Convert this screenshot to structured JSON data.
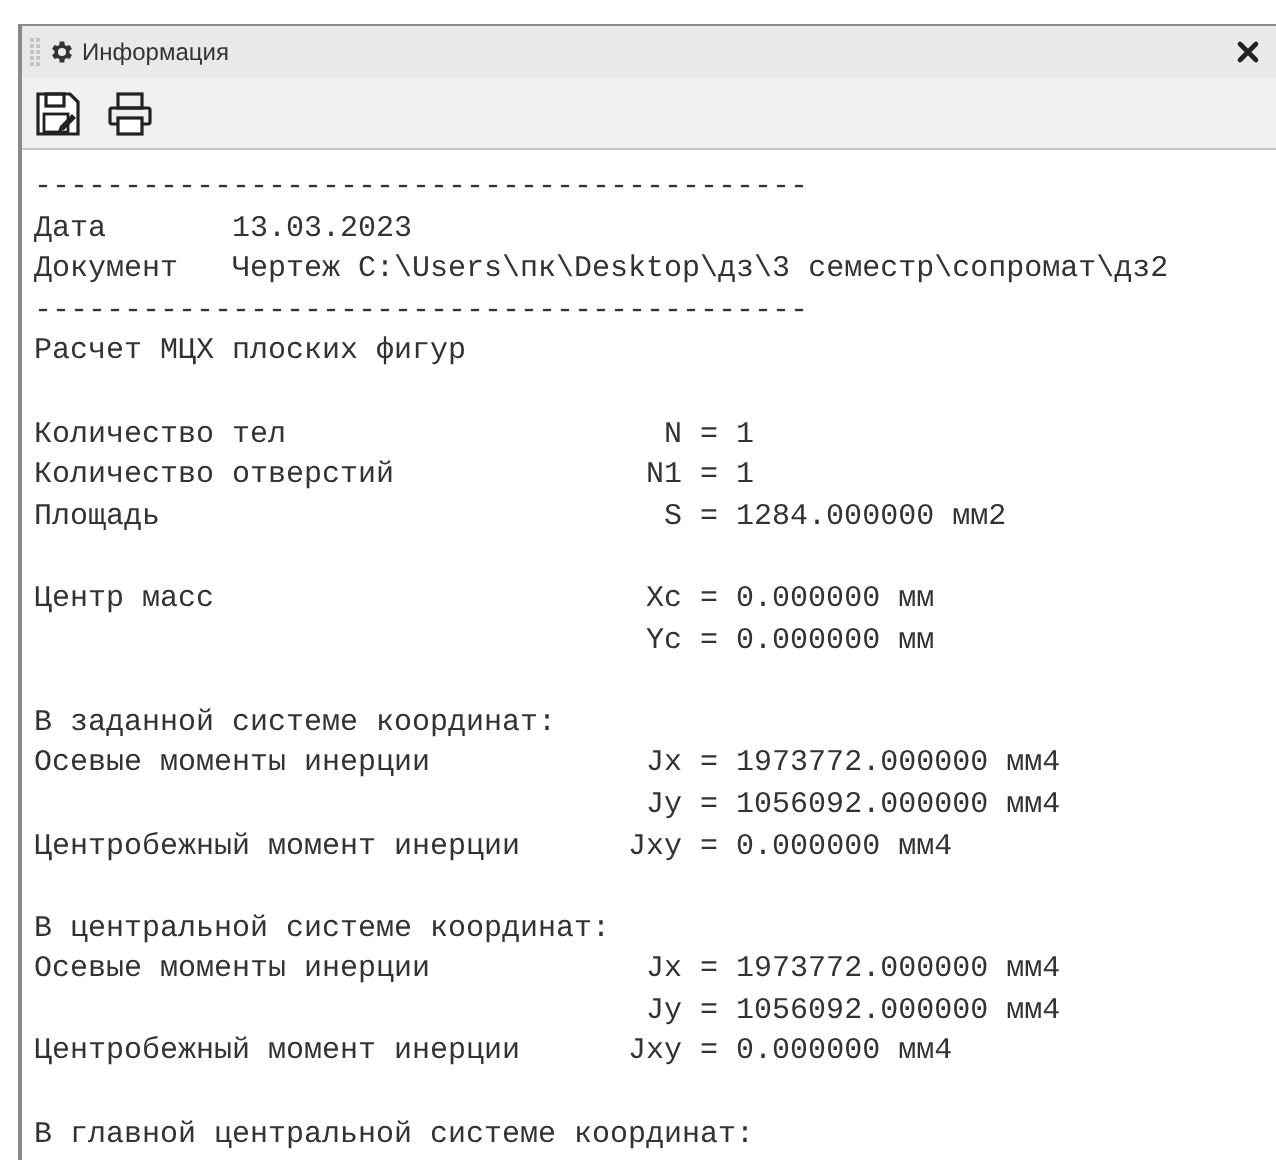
{
  "window": {
    "title": "Информация"
  },
  "report": [
    {
      "kind": "text",
      "text": "-------------------------------------------"
    },
    {
      "kind": "field",
      "label": "Дата",
      "value": "13.03.2023"
    },
    {
      "kind": "field",
      "label": "Документ",
      "value": "Чертеж C:\\Users\\пк\\Desktop\\дз\\3 семестр\\сопромат\\дз2"
    },
    {
      "kind": "text",
      "text": "-------------------------------------------"
    },
    {
      "kind": "text",
      "text": "Расчет МЦХ плоских фигур"
    },
    {
      "kind": "blank"
    },
    {
      "kind": "result",
      "label": "Количество тел",
      "value": "N = 1"
    },
    {
      "kind": "result",
      "label": "Количество отверстий",
      "value": "N1 = 1"
    },
    {
      "kind": "result",
      "label": "Площадь",
      "value": "S = 1284.000000 мм2"
    },
    {
      "kind": "blank"
    },
    {
      "kind": "result",
      "label": "Центр масс",
      "value": "Xc = 0.000000 мм"
    },
    {
      "kind": "result",
      "value": "Yc = 0.000000 мм"
    },
    {
      "kind": "blank"
    },
    {
      "kind": "text",
      "text": "В заданной системе координат:"
    },
    {
      "kind": "result",
      "label": "Осевые моменты инерции",
      "value": "Jx = 1973772.000000 мм4"
    },
    {
      "kind": "result",
      "value": "Jy = 1056092.000000 мм4"
    },
    {
      "kind": "result",
      "label": "Центробежный момент инерции",
      "value": "Jxy = 0.000000 мм4"
    },
    {
      "kind": "blank"
    },
    {
      "kind": "text",
      "text": "В центральной системе координат:"
    },
    {
      "kind": "result",
      "label": "Осевые моменты инерции",
      "value": "Jx = 1973772.000000 мм4"
    },
    {
      "kind": "result",
      "value": "Jy = 1056092.000000 мм4"
    },
    {
      "kind": "result",
      "label": "Центробежный момент инерции",
      "value": "Jxy = 0.000000 мм4"
    },
    {
      "kind": "blank"
    },
    {
      "kind": "text",
      "text": "В главной центральной системе координат:"
    }
  ]
}
